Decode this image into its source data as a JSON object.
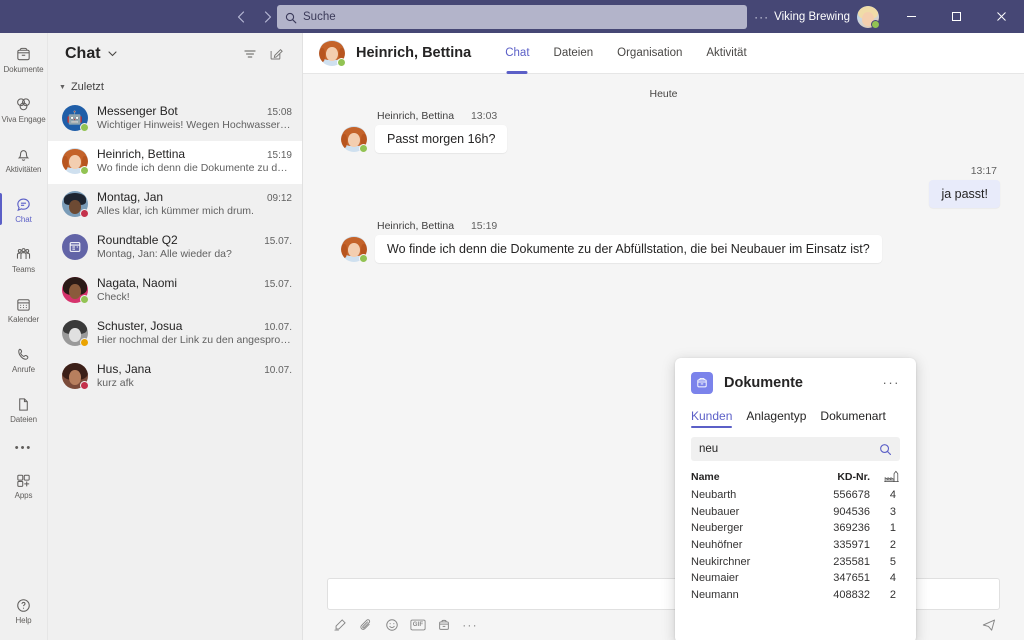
{
  "titlebar": {
    "back_label": "‹",
    "forward_label": "›",
    "search_placeholder": "Suche",
    "search_icon": "search-icon",
    "more_label": "···",
    "org_label": "Viking Brewing",
    "minimize_label": "minimize-icon",
    "maximize_label": "maximize-icon",
    "close_label": "close-icon",
    "accent": "#464775"
  },
  "rail": {
    "items": [
      {
        "label": "Dokumente",
        "icon": "archive-box-icon",
        "active": false
      },
      {
        "label": "Viva Engage",
        "icon": "viva-engage-icon",
        "active": false
      },
      {
        "label": "Aktivitäten",
        "icon": "bell-icon",
        "active": false
      },
      {
        "label": "Chat",
        "icon": "chat-bubble-icon",
        "active": true
      },
      {
        "label": "Teams",
        "icon": "people-icon",
        "active": false
      },
      {
        "label": "Kalender",
        "icon": "calendar-icon",
        "active": false
      },
      {
        "label": "Anrufe",
        "icon": "phone-icon",
        "active": false
      },
      {
        "label": "Dateien",
        "icon": "file-icon",
        "active": false
      }
    ],
    "more_label": "•••",
    "apps": {
      "label": "Apps",
      "icon": "apps-grid-icon"
    },
    "help": {
      "label": "Help",
      "icon": "question-circle-icon"
    },
    "active_color": "#5b5fc7"
  },
  "chatlist": {
    "title": "Chat",
    "caret_icon": "chevron-down-icon",
    "filter_icon": "filter-icon",
    "compose_icon": "new-chat-icon",
    "section_label": "Zuletzt",
    "items": [
      {
        "name": "Messenger Bot",
        "preview": "Wichtiger Hinweis! Wegen Hochwassergefahr is…",
        "time": "15:08",
        "presence": "available",
        "avatar": "bot"
      },
      {
        "name": "Heinrich, Bettina",
        "preview": "Wo finde ich denn die Dokumente zu der Abfüll…",
        "time": "15:19",
        "presence": "available",
        "avatar": "bettina",
        "selected": true
      },
      {
        "name": "Montag, Jan",
        "preview": "Alles klar, ich kümmer mich drum.",
        "time": "09:12",
        "presence": "busy",
        "avatar": "jan"
      },
      {
        "name": "Roundtable Q2",
        "preview": "Montag, Jan: Alle wieder da?",
        "time": "15.07.",
        "presence": "none",
        "avatar": "roundtable"
      },
      {
        "name": "Nagata, Naomi",
        "preview": "Check!",
        "time": "15.07.",
        "presence": "available",
        "avatar": "naomi"
      },
      {
        "name": "Schuster, Josua",
        "preview": "Hier nochmal der Link zu den angesprochene…",
        "time": "10.07.",
        "presence": "away",
        "avatar": "josua"
      },
      {
        "name": "Hus, Jana",
        "preview": "kurz afk",
        "time": "10.07.",
        "presence": "busy",
        "avatar": "jana"
      }
    ]
  },
  "chat_header": {
    "name": "Heinrich, Bettina",
    "presence": "available",
    "tabs": [
      {
        "label": "Chat",
        "active": true
      },
      {
        "label": "Dateien",
        "active": false
      },
      {
        "label": "Organisation",
        "active": false
      },
      {
        "label": "Aktivität",
        "active": false
      }
    ]
  },
  "conversation": {
    "day_divider": "Heute",
    "messages": [
      {
        "direction": "in",
        "author": "Heinrich, Bettina",
        "time": "13:03",
        "text": "Passt morgen 16h?",
        "presence": "available"
      },
      {
        "direction": "out",
        "author": "",
        "time": "13:17",
        "text": "ja passt!"
      },
      {
        "direction": "in",
        "author": "Heinrich, Bettina",
        "time": "15:19",
        "text": "Wo finde ich denn die Dokumente zu der Abfüllstation, die bei Neubauer im Einsatz ist?",
        "presence": "available"
      }
    ]
  },
  "compose": {
    "input_value": "",
    "tools": [
      {
        "name": "format-icon",
        "glyph": "format"
      },
      {
        "name": "attach-icon",
        "glyph": "attach"
      },
      {
        "name": "emoji-icon",
        "glyph": "emoji"
      },
      {
        "name": "giphy-icon",
        "glyph": "GIF"
      },
      {
        "name": "sticker-icon",
        "glyph": "sticker"
      },
      {
        "name": "more-options-icon",
        "glyph": "more"
      }
    ],
    "send_icon": "send-icon"
  },
  "panel": {
    "app_icon": "archive-box-icon",
    "title": "Dokumente",
    "more_label": "···",
    "tabs": [
      {
        "label": "Kunden",
        "active": true
      },
      {
        "label": "Anlagentyp",
        "active": false
      },
      {
        "label": "Dokumenart",
        "active": false
      }
    ],
    "search_value": "neu",
    "search_icon": "search-icon",
    "table": {
      "columns": [
        "Name",
        "KD-Nr.",
        "plant-icon"
      ],
      "rows": [
        {
          "name": "Neubarth",
          "kd": "556678",
          "count": "4"
        },
        {
          "name": "Neubauer",
          "kd": "904536",
          "count": "3"
        },
        {
          "name": "Neuberger",
          "kd": "369236",
          "count": "1"
        },
        {
          "name": "Neuhöfner",
          "kd": "335971",
          "count": "2"
        },
        {
          "name": "Neukirchner",
          "kd": "235581",
          "count": "5"
        },
        {
          "name": "Neumaier",
          "kd": "347651",
          "count": "4"
        },
        {
          "name": "Neumann",
          "kd": "408832",
          "count": "2"
        }
      ]
    },
    "accent": "#5b5fc7"
  }
}
